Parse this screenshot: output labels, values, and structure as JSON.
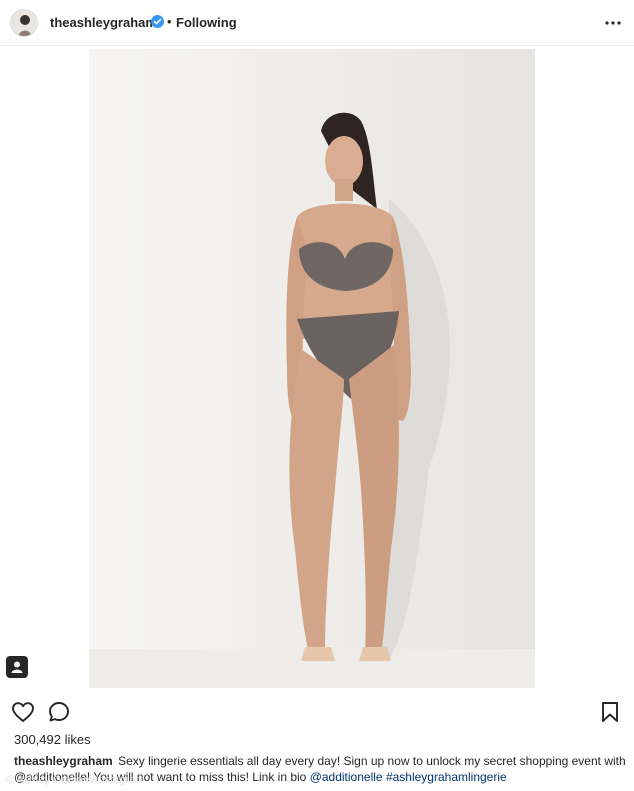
{
  "header": {
    "username": "theashleygraham",
    "separator": "•",
    "follow_status": "Following"
  },
  "post": {
    "likes": "300,492 likes",
    "caption": {
      "username": "theashleygraham",
      "text": "Sexy lingerie essentials all day every day! Sign up now to unlock my secret shopping event with @additionelle! You will not want to miss this! Link in bio ",
      "mention": "@additionelle",
      "hashtag": "#ashleygrahamlingerie"
    }
  },
  "watermark": "© Ashley Graham/Instagram",
  "colors": {
    "text": "#262626",
    "link": "#003569",
    "verified": "#3897f0"
  },
  "icons": [
    "verified-badge-icon",
    "more-options-icon",
    "heart-icon",
    "comment-icon",
    "bookmark-icon",
    "user-tag-icon"
  ]
}
